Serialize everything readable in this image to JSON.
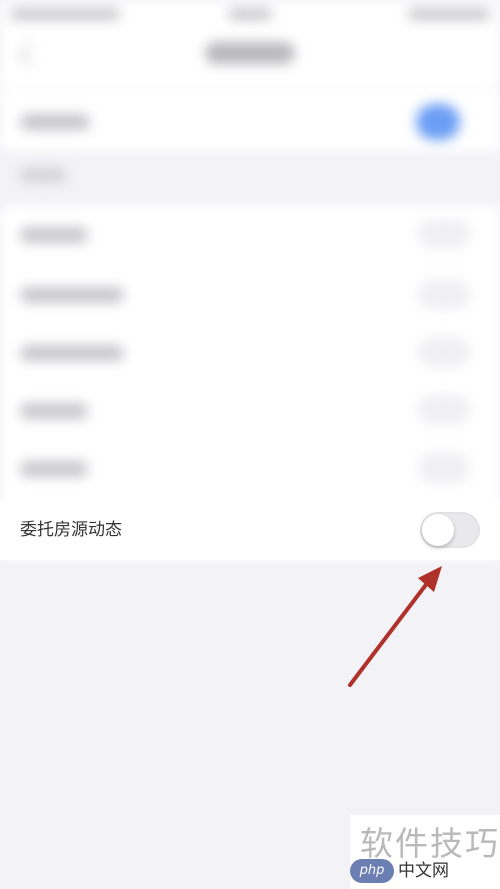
{
  "setting_row": {
    "label": "委托房源动态",
    "toggle_state": "off"
  },
  "watermark": {
    "text": "软件技巧",
    "logo": "php",
    "site": "中文网"
  },
  "colors": {
    "arrow": "#b0302a",
    "toggle_track_off": "#e9e9ec",
    "accent_blurred_toggle": "#6b9ef5"
  }
}
